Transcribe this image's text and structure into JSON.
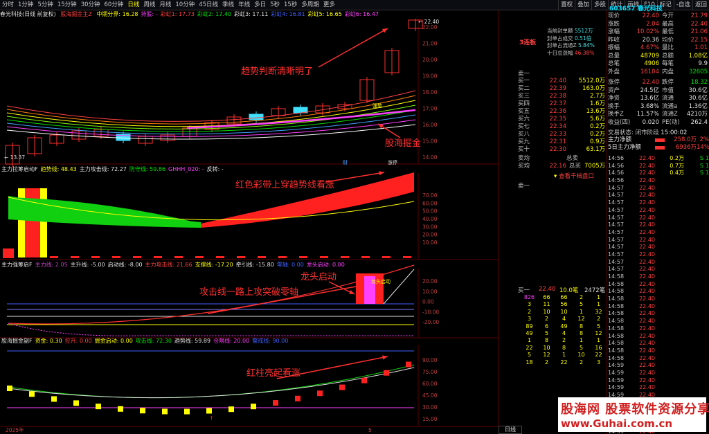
{
  "toolbar": {
    "periods": [
      "分时",
      "1分钟",
      "5分钟",
      "15分钟",
      "30分钟",
      "60分钟",
      "日线",
      "周线",
      "月线",
      "10分钟",
      "45日线",
      "季线",
      "年线",
      "多日",
      "5秒",
      "15秒",
      "多周期",
      "更多"
    ],
    "active_period": "日线",
    "right_buttons": [
      "置权",
      "叠加",
      "多股",
      "统计",
      "画线",
      "F10",
      "标记",
      "-自选",
      "返回"
    ]
  },
  "main_panel": {
    "title": "春光科技(日线 前复权)",
    "indicator": "股海掘金主Z",
    "params": [
      {
        "label": "中期分界: 16.28",
        "color": "#ffff00"
      },
      {
        "label": "持股: -",
        "color": "#ff40ff"
      },
      {
        "label": "彩虹1: 17.73",
        "color": "#ff4040"
      },
      {
        "label": "彩虹2: 17.40",
        "color": "#00e000"
      },
      {
        "label": "彩虹3: 17.11",
        "color": "#e0e0e0"
      },
      {
        "label": "彩虹4: 16.81",
        "color": "#4060ff"
      },
      {
        "label": "彩虹5: 16.65",
        "color": "#ffff00"
      },
      {
        "label": "彩虹6: 16.47",
        "color": "#ff40ff"
      }
    ],
    "axis": [
      "22.00",
      "21.00",
      "20.00",
      "19.00",
      "18.00",
      "17.00",
      "16.00",
      "15.00",
      "14.00"
    ],
    "high_label": "22.40",
    "low_label": "13.37",
    "marker_text": "强势",
    "ann1": "趋势判断清晰明了",
    "ann2": "股海掘金",
    "lianban": "3连板",
    "limit_info": [
      "当前封单额 5512万",
      "封单占成交 0.51倍",
      "封单占流通Z 5.84%",
      "十日总涨幅 46.38%"
    ],
    "bottom_labels": [
      "财",
      "涨停"
    ]
  },
  "panel2": {
    "title": "主力拉筹启动F",
    "params": [
      {
        "label": "趋势线: 48.43",
        "color": "#ffff00"
      },
      {
        "label": "主力攻击线: 72.27",
        "color": "#e0e0e0"
      },
      {
        "label": "防守线: 59.86",
        "color": "#00e000"
      },
      {
        "label": "GHHH_020: -",
        "color": "#ff40ff"
      },
      {
        "label": "反转: -",
        "color": "#e0e0e0"
      }
    ],
    "axis": [
      "70.00",
      "60.00",
      "50.00",
      "40.00",
      "30.00",
      "20.00",
      "10.00"
    ],
    "ann": "红色彩带上穿趋势线看涨",
    "bar_label": "启动"
  },
  "panel3": {
    "title": "主力强筹启F",
    "params": [
      {
        "label": "主力线: 2.05",
        "color": "#c040c0"
      },
      {
        "label": "主升线: -5.00",
        "color": "#e0e0e0"
      },
      {
        "label": "启动线: -8.00",
        "color": "#e0e0e0"
      },
      {
        "label": "主力攻击线: 21.66",
        "color": "#ff4040"
      },
      {
        "label": "支撑线: -17.20",
        "color": "#ffff00"
      },
      {
        "label": "牵引线: -15.80",
        "color": "#e0e0e0"
      },
      {
        "label": "零轴: 0.00",
        "color": "#4060ff"
      },
      {
        "label": "龙头启动: 0.00",
        "color": "#ff40ff"
      }
    ],
    "axis": [
      "20.00",
      "10.00",
      "0.00",
      "-10.00",
      "-20.00"
    ],
    "ann1": "攻击线一路上攻突破零轴",
    "ann2": "龙头启动",
    "bar_label": "龙头启动"
  },
  "panel4": {
    "title": "股海掘金副F",
    "params": [
      {
        "label": "资金: 0.30",
        "color": "#ffff00"
      },
      {
        "label": "拉升: 0.00",
        "color": "#ff4040"
      },
      {
        "label": "掘金启动: 0.00",
        "color": "#ffff00"
      },
      {
        "label": "攻击线: 72.30",
        "color": "#00e000"
      },
      {
        "label": "趋势线: 59.89",
        "color": "#e0e0e0"
      },
      {
        "label": "仓限线: 20.00",
        "color": "#ff40ff"
      },
      {
        "label": "警戒线: 90.00",
        "color": "#4060ff"
      }
    ],
    "axis": [
      "90.00",
      "75.00",
      "60.00",
      "45.00",
      "30.00",
      "15.00"
    ],
    "ann": "红柱亮起看涨"
  },
  "x_axis": {
    "year": "2025年",
    "month": "5"
  },
  "quote": {
    "code": "603657",
    "name": "春光科技",
    "info": [
      [
        "现价",
        "22.40",
        "今开",
        "21.79"
      ],
      [
        "涨跌",
        "2.04",
        "最高",
        "22.40"
      ],
      [
        "涨幅",
        "10.02%",
        "最低",
        "21.06"
      ],
      [
        "昨收",
        "20.36",
        "均价",
        "22.15"
      ],
      [
        "振幅",
        "4.67%",
        "量比",
        "1.01"
      ],
      [
        "总量",
        "48709",
        "总额",
        "1.08亿"
      ],
      [
        "总笔",
        "4906",
        "每笔",
        "9.9"
      ],
      [
        "外盘",
        "16104",
        "内盘",
        "32605"
      ]
    ],
    "asks_label": "卖一",
    "order_book": [
      [
        "买一",
        "22.40",
        "5512.0万"
      ],
      [
        "买二",
        "22.39",
        "163.0万"
      ],
      [
        "买三",
        "22.38",
        "2.7万"
      ],
      [
        "买四",
        "22.37",
        "1.6万"
      ],
      [
        "买五",
        "22.36",
        "13.6万"
      ],
      [
        "买六",
        "22.35",
        "5.6万"
      ],
      [
        "买七",
        "22.34",
        "0.2万"
      ],
      [
        "买八",
        "22.33",
        "0.2万"
      ],
      [
        "买九",
        "22.31",
        "0.9万"
      ],
      [
        "买十",
        "22.30",
        "63.1万"
      ]
    ],
    "bid_avg": [
      "卖均",
      "总卖"
    ],
    "buy_avg": [
      "买均",
      "22.16",
      "总买",
      "7005万"
    ],
    "stats": [
      [
        "涨停",
        "22.40",
        "跌停",
        "18.32"
      ],
      [
        "资产",
        "24.5亿",
        "市值",
        "30.6亿"
      ],
      [
        "净资",
        "13.6亿",
        "流通",
        "30.6亿"
      ],
      [
        "换手",
        "3.68%",
        "流通a",
        "1.36亿"
      ],
      [
        "换手Z",
        "11.57%",
        "流通Z",
        "4210万"
      ],
      [
        "收益(四)",
        "0.020",
        "PE(动)",
        "262.4"
      ]
    ],
    "status_label": "交易状态: 闭市阶段",
    "status_time": "15:00:02",
    "net": [
      [
        "主力净额",
        "258.0万",
        "2%"
      ],
      [
        "5日主力净额",
        "6936万",
        "14%"
      ]
    ],
    "view_more": "查看千档盘口",
    "bid_one": [
      "买一",
      "22.40",
      "10.0笔",
      "2472笔"
    ],
    "queue": [
      [
        "826",
        "66",
        "66",
        "2",
        "1"
      ],
      [
        "3",
        "11",
        "56",
        "5",
        "1"
      ],
      [
        "2",
        "10",
        "10",
        "1",
        "32"
      ],
      [
        "3",
        "2",
        "4",
        "12",
        "2"
      ],
      [
        "89",
        "6",
        "49",
        "8",
        "5"
      ],
      [
        "49",
        "5",
        "4",
        "8",
        "12"
      ],
      [
        "1",
        "8",
        "2",
        "1",
        "1"
      ],
      [
        "22",
        "10",
        "8",
        "5",
        "16"
      ],
      [
        "5",
        "12",
        "1",
        "10",
        "22"
      ],
      [
        "18",
        "2",
        "22",
        "2",
        "3"
      ]
    ],
    "ticks": [
      [
        "14:56",
        "22.40",
        "0.2万",
        "S",
        "1"
      ],
      [
        "14:56",
        "22.40",
        "0.7万",
        "S",
        "1"
      ],
      [
        "14:56",
        "22.40",
        "0.4万",
        "S",
        "1"
      ],
      [
        "14:56",
        "22.40",
        "",
        "",
        ""
      ],
      [
        "14:57",
        "22.40",
        "",
        "",
        ""
      ],
      [
        "14:57",
        "22.40",
        "",
        "",
        ""
      ],
      [
        "14:57",
        "22.40",
        "",
        "",
        ""
      ],
      [
        "14:57",
        "22.40",
        "",
        "",
        ""
      ],
      [
        "14:57",
        "22.40",
        "",
        "",
        ""
      ],
      [
        "14:57",
        "22.40",
        "",
        "",
        ""
      ],
      [
        "14:57",
        "22.40",
        "",
        "",
        ""
      ],
      [
        "14:57",
        "22.40",
        "",
        "",
        ""
      ],
      [
        "14:57",
        "22.40",
        "",
        "",
        ""
      ],
      [
        "14:57",
        "22.40",
        "",
        "",
        ""
      ],
      [
        "14:57",
        "22.40",
        "",
        "",
        ""
      ],
      [
        "14:57",
        "22.40",
        "",
        "",
        ""
      ],
      [
        "14:58",
        "22.40",
        "",
        "",
        ""
      ],
      [
        "14:58",
        "22.40",
        "",
        "",
        ""
      ],
      [
        "14:58",
        "22.40",
        "",
        "",
        ""
      ],
      [
        "14:58",
        "22.40",
        "",
        "",
        ""
      ],
      [
        "14:58",
        "22.40",
        "",
        "",
        ""
      ],
      [
        "14:58",
        "22.40",
        "",
        "",
        ""
      ],
      [
        "14:58",
        "22.40",
        "",
        "",
        ""
      ],
      [
        "14:58",
        "22.40",
        "",
        "",
        ""
      ],
      [
        "14:58",
        "22.40",
        "",
        "",
        ""
      ],
      [
        "14:58",
        "22.40",
        "",
        "",
        ""
      ],
      [
        "14:58",
        "22.40",
        "",
        "",
        ""
      ],
      [
        "14:58",
        "22.40",
        "",
        "",
        ""
      ],
      [
        "14:59",
        "22.40",
        "",
        "",
        ""
      ],
      [
        "14:59",
        "22.40",
        "",
        "",
        ""
      ],
      [
        "14:59",
        "22.40",
        "",
        "",
        ""
      ],
      [
        "14:59",
        "22.40",
        "",
        "",
        ""
      ],
      [
        "14:59",
        "22.40",
        "",
        "",
        ""
      ],
      [
        "14:59",
        "22.40",
        "",
        "",
        ""
      ],
      [
        "14:59",
        "22.40",
        "",
        "",
        ""
      ],
      [
        "14:59",
        "22.40",
        "",
        "",
        ""
      ],
      [
        "14:59",
        "22.40",
        "",
        "",
        ""
      ],
      [
        "14:59",
        "22.40",
        "",
        "",
        ""
      ]
    ],
    "period_tab": "日线"
  },
  "watermark": {
    "line1": "股海网 股票软件资源分享",
    "line2": "www.Guhai.com.cn"
  }
}
